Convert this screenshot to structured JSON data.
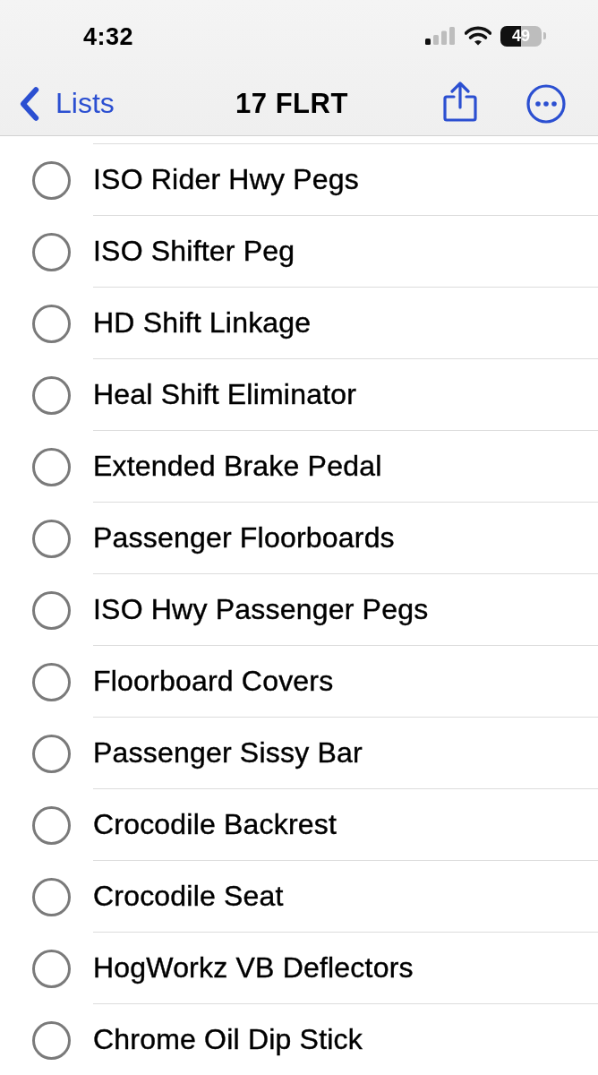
{
  "status_bar": {
    "time": "4:32",
    "battery": "49"
  },
  "nav": {
    "back_label": "Lists",
    "title": "17 FLRT"
  },
  "items": [
    {
      "text": "ISO Rider Hwy Pegs",
      "checked": false
    },
    {
      "text": "ISO Shifter Peg",
      "checked": false
    },
    {
      "text": "HD Shift Linkage",
      "checked": false
    },
    {
      "text": "Heal Shift Eliminator",
      "checked": false
    },
    {
      "text": "Extended Brake Pedal",
      "checked": false
    },
    {
      "text": "Passenger Floorboards",
      "checked": false
    },
    {
      "text": "ISO Hwy Passenger Pegs",
      "checked": false
    },
    {
      "text": "Floorboard Covers",
      "checked": false
    },
    {
      "text": "Passenger Sissy Bar",
      "checked": false
    },
    {
      "text": "Crocodile Backrest",
      "checked": false
    },
    {
      "text": "Crocodile Seat",
      "checked": false
    },
    {
      "text": "HogWorkz VB Deflectors",
      "checked": false
    },
    {
      "text": "Chrome Oil Dip Stick",
      "checked": false
    }
  ]
}
